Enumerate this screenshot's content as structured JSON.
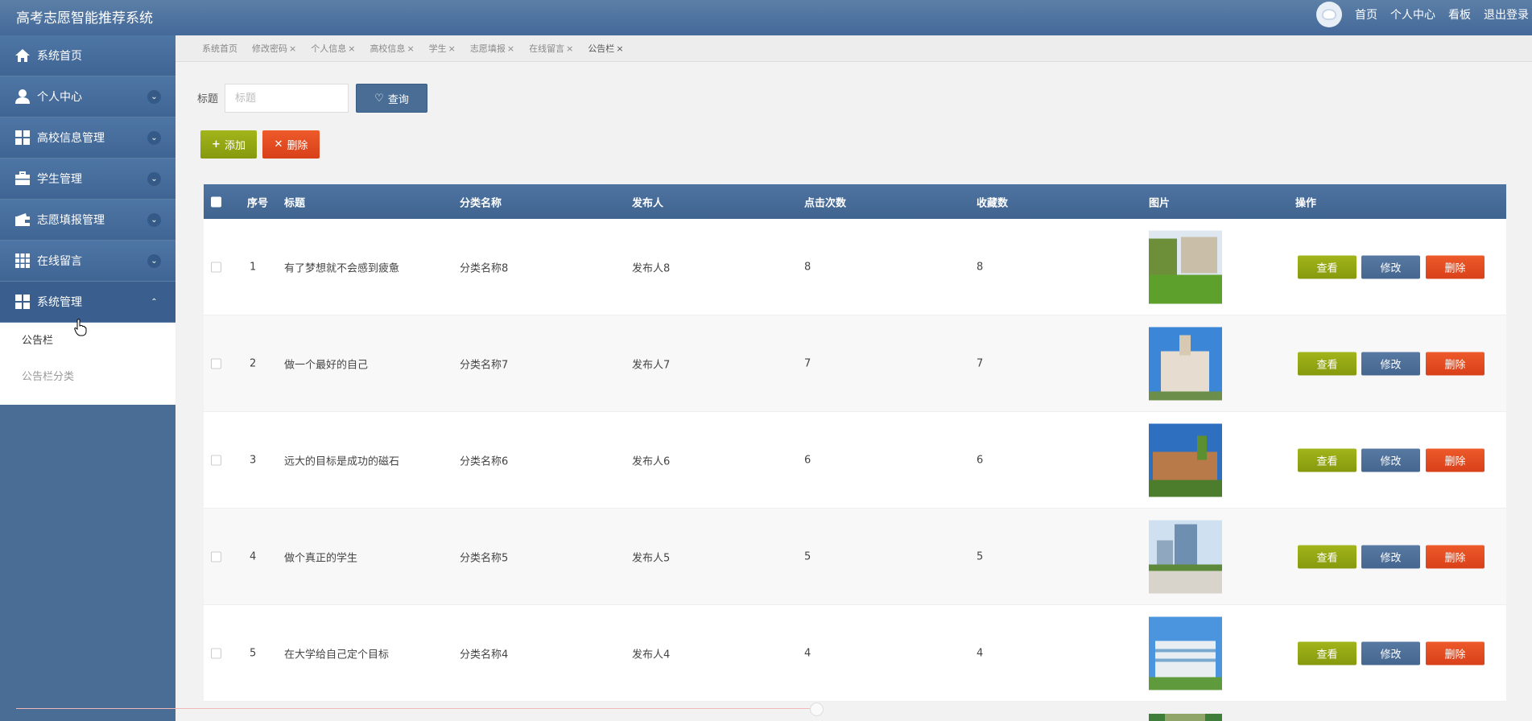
{
  "app_title": "高考志愿智能推荐系统",
  "header_links": [
    "首页",
    "个人中心",
    "看板",
    "退出登录"
  ],
  "sidebar": {
    "items": [
      {
        "label": "系统首页",
        "icon": "home-icon",
        "expandable": false
      },
      {
        "label": "个人中心",
        "icon": "user-icon",
        "expandable": true
      },
      {
        "label": "高校信息管理",
        "icon": "grid-icon",
        "expandable": true
      },
      {
        "label": "学生管理",
        "icon": "briefcase-icon",
        "expandable": true
      },
      {
        "label": "志愿填报管理",
        "icon": "wallet-icon",
        "expandable": true
      },
      {
        "label": "在线留言",
        "icon": "apps-icon",
        "expandable": true
      },
      {
        "label": "系统管理",
        "icon": "grid-icon",
        "expandable": true,
        "open": true
      }
    ],
    "submenu": [
      "公告栏",
      "公告栏分类"
    ]
  },
  "tabs": [
    {
      "label": "系统首页",
      "closable": false
    },
    {
      "label": "修改密码",
      "closable": true
    },
    {
      "label": "个人信息",
      "closable": true
    },
    {
      "label": "高校信息",
      "closable": true
    },
    {
      "label": "学生",
      "closable": true
    },
    {
      "label": "志愿填报",
      "closable": true
    },
    {
      "label": "在线留言",
      "closable": true
    },
    {
      "label": "公告栏",
      "closable": true,
      "active": true
    }
  ],
  "search": {
    "label": "标题",
    "placeholder": "标题",
    "value": "",
    "button": "查询"
  },
  "toolbar": {
    "add": "添加",
    "delete": "删除"
  },
  "table": {
    "headers": [
      "序号",
      "标题",
      "分类名称",
      "发布人",
      "点击次数",
      "收藏数",
      "图片",
      "操作"
    ],
    "rows": [
      {
        "no": "1",
        "title": "有了梦想就不会感到疲惫",
        "category": "分类名称8",
        "publisher": "发布人8",
        "clicks": "8",
        "favorites": "8"
      },
      {
        "no": "2",
        "title": "做一个最好的自己",
        "category": "分类名称7",
        "publisher": "发布人7",
        "clicks": "7",
        "favorites": "7"
      },
      {
        "no": "3",
        "title": "远大的目标是成功的磁石",
        "category": "分类名称6",
        "publisher": "发布人6",
        "clicks": "6",
        "favorites": "6"
      },
      {
        "no": "4",
        "title": "做个真正的学生",
        "category": "分类名称5",
        "publisher": "发布人5",
        "clicks": "5",
        "favorites": "5"
      },
      {
        "no": "5",
        "title": "在大学给自己定个目标",
        "category": "分类名称4",
        "publisher": "发布人4",
        "clicks": "4",
        "favorites": "4"
      }
    ],
    "actions": {
      "view": "查看",
      "edit": "修改",
      "delete": "删除"
    }
  },
  "colors": {
    "primary": "#4a6d96",
    "green": "#94a614",
    "red": "#e4492a"
  }
}
